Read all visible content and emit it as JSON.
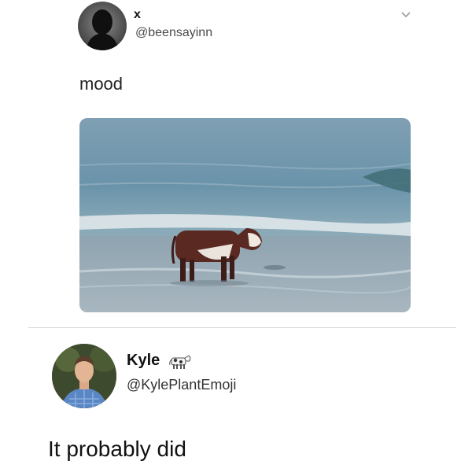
{
  "original_tweet": {
    "author_name": "x",
    "author_handle": "@beensayinn",
    "text": "mood",
    "media_description_icon": "cow-on-beach-photo"
  },
  "reply_tweet": {
    "author_name": "Kyle",
    "author_emoji": "cow-emoji",
    "author_handle": "@KylePlantEmoji",
    "text": "It probably did"
  },
  "colors": {
    "background": "#ffffff",
    "handle_gray": "#4a4a4a",
    "divider": "#d9d9d9",
    "ocean": "#6f97ad",
    "cow_brown": "#5a2a22"
  }
}
